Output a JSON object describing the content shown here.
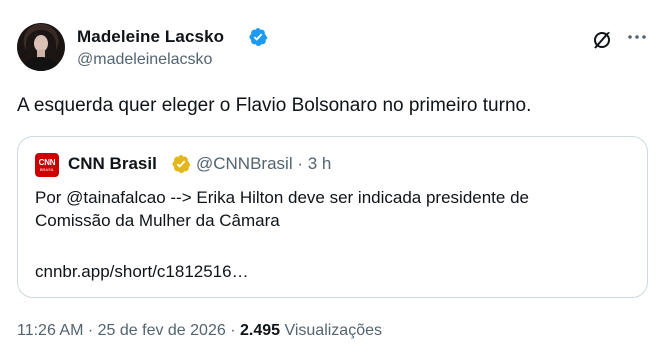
{
  "author": {
    "name": "Madeleine Lacsko",
    "handle": "@madeleinelacsko",
    "verified_color": "#1d9bf0"
  },
  "tweet": {
    "text": "A esquerda quer eleger o Flavio Bolsonaro no primeiro turno."
  },
  "quoted": {
    "logo_text": "CNN",
    "logo_subtext": "BRASIL",
    "name": "CNN Brasil",
    "handle_time": "@CNNBrasil · 3 h",
    "text_line1": "Por @tainafalcao --> Erika Hilton deve ser indicada presidente de",
    "text_line2": "Comissão da Mulher da Câmara",
    "link": "cnnbr.app/short/c1812516…",
    "badge_color": "#e2b719"
  },
  "meta": {
    "time_date": "11:26 AM · 25 de fev de 2026 · ",
    "views_count": "2.495",
    "views_label": " Visualizações"
  },
  "icons": {
    "grok": "grok-icon",
    "more": "more-icon"
  }
}
